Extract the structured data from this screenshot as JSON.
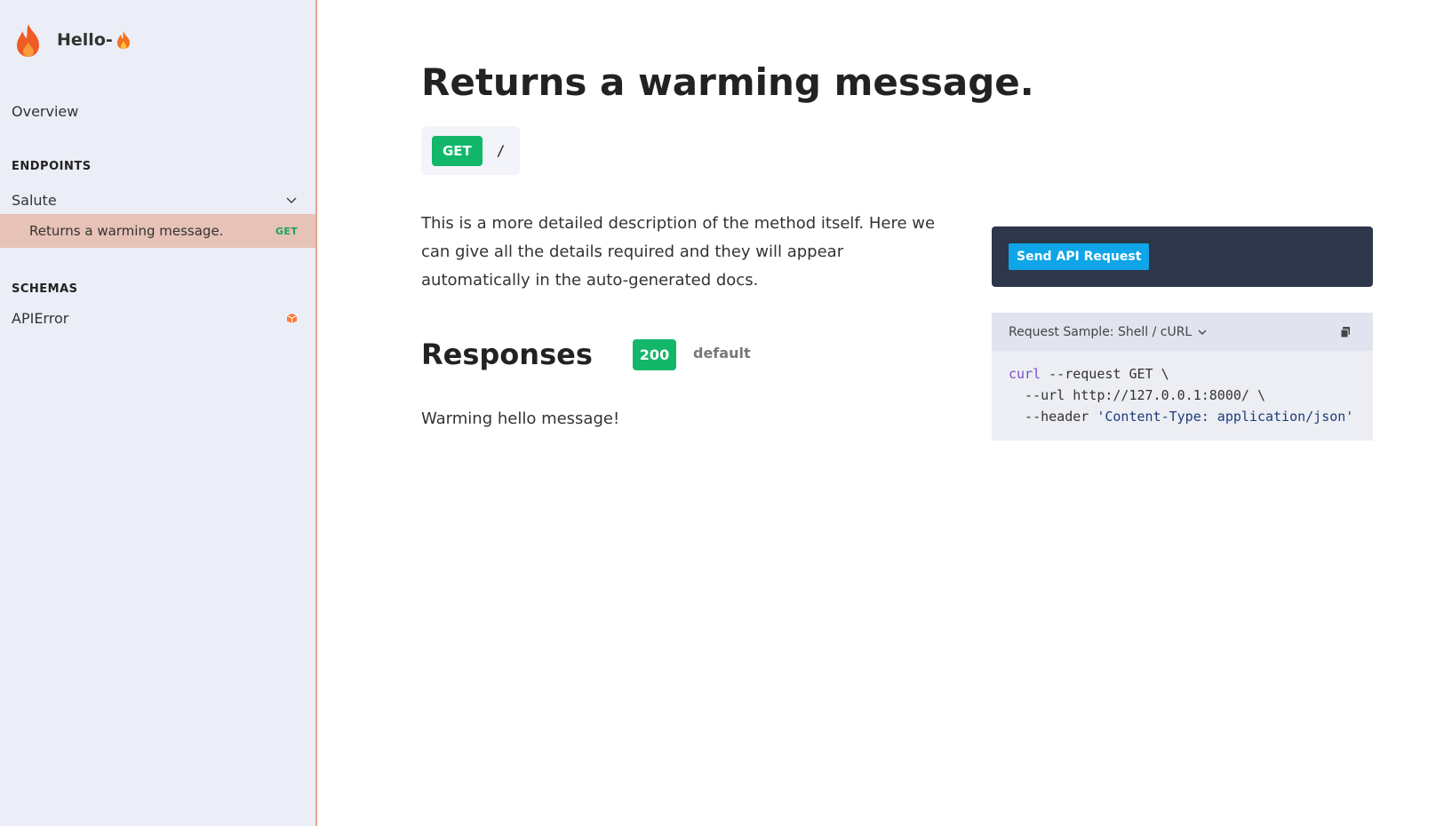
{
  "app": {
    "title": "Hello-",
    "title_emoji": "flame-emoji-icon",
    "logo": "flame-icon"
  },
  "sidebar": {
    "overview_label": "Overview",
    "endpoints_heading": "ENDPOINTS",
    "group_label": "Salute",
    "active_item": {
      "label": "Returns a warming message.",
      "method": "GET"
    },
    "schemas_heading": "SCHEMAS",
    "schema_item": {
      "label": "APIError",
      "icon": "cube-icon"
    }
  },
  "main": {
    "title": "Returns a warming message.",
    "method": "GET",
    "path": "/",
    "description": "This is a more detailed description of the method itself. Here we can give all the details required and they will appear automatically in the auto-generated docs.",
    "responses_heading": "Responses",
    "response_code": "200",
    "response_tab": "default",
    "response_text": "Warming hello message!"
  },
  "panel": {
    "send_button": "Send API Request",
    "sample_label": "Request Sample: Shell / cURL",
    "code": {
      "line1_cmd": "curl",
      "line1_rest": " --request GET \\",
      "line2": "  --url http://127.0.0.1:8000/ \\",
      "line3_flag": "  --header ",
      "line3_str": "'Content-Type: application/json'"
    }
  },
  "colors": {
    "accent": "#12b76a",
    "sidebar_bg": "#eceef7",
    "active_bg": "#e7c2b6",
    "panel_dark": "#2d3749",
    "button_blue": "#0ea5e9"
  }
}
